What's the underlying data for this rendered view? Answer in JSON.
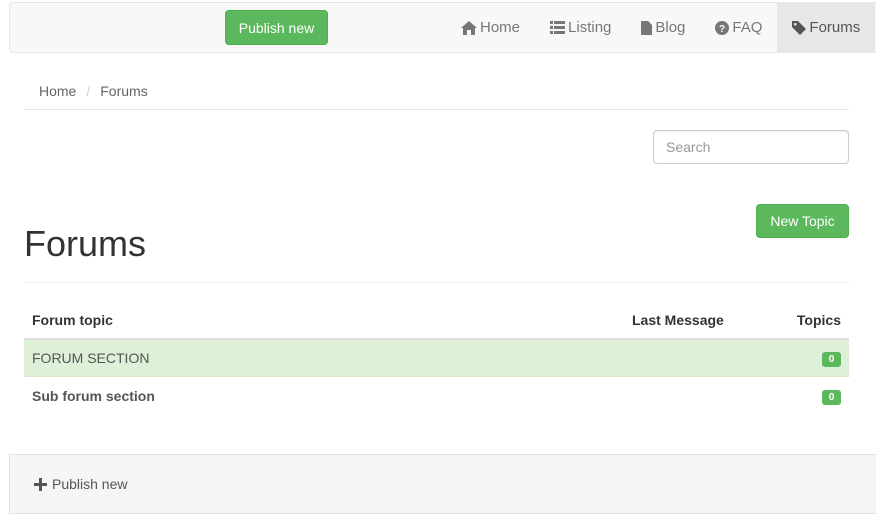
{
  "navbar": {
    "publish_label": "Publish new",
    "links": [
      {
        "label": "Home",
        "icon": "home-icon"
      },
      {
        "label": "Listing",
        "icon": "list-icon"
      },
      {
        "label": "Blog",
        "icon": "file-icon"
      },
      {
        "label": "FAQ",
        "icon": "question-circle-icon"
      },
      {
        "label": "Forums",
        "icon": "tag-icon",
        "active": true
      }
    ]
  },
  "breadcrumb": {
    "items": [
      "Home",
      "Forums"
    ],
    "separator": "/"
  },
  "search": {
    "placeholder": "Search"
  },
  "page": {
    "title": "Forums",
    "new_topic_label": "New Topic"
  },
  "table": {
    "headers": {
      "topic": "Forum topic",
      "last_message": "Last Message",
      "topics": "Topics"
    },
    "rows": [
      {
        "name": "FORUM SECTION",
        "last_message": "",
        "topics": "0",
        "type": "section"
      },
      {
        "name": "Sub forum section",
        "last_message": "",
        "topics": "0",
        "type": "sub"
      }
    ]
  },
  "footer": {
    "publish_label": "Publish new",
    "icon": "plus-icon"
  },
  "colors": {
    "accent_green": "#5cb85c",
    "section_bg": "#dff0d8",
    "navbar_bg": "#f8f8f8",
    "active_nav_bg": "#e7e7e7"
  }
}
